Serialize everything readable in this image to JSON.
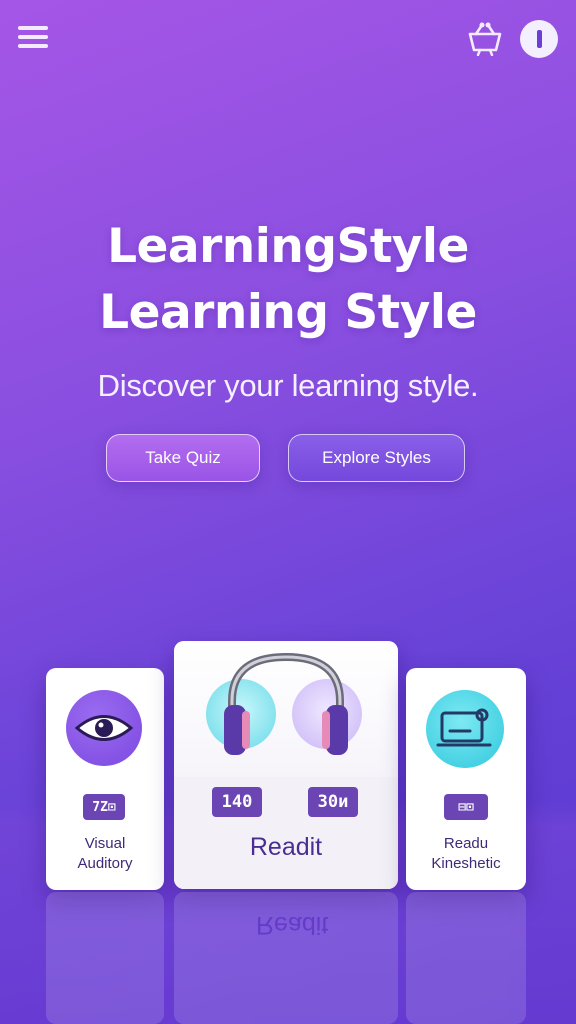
{
  "header": {
    "menu_icon": "hamburger-menu-icon",
    "basket_icon": "basket-icon",
    "info_icon": "info-icon"
  },
  "hero": {
    "title_line1": "LearningStyle",
    "title_line2": "Learning Style",
    "subtitle": "Discover your learning style."
  },
  "actions": {
    "take_quiz": "Take Quiz",
    "explore_styles": "Explore Styles"
  },
  "cards": {
    "left": {
      "icon": "eye-icon",
      "badge": "7Z⊡",
      "label_line1": "Visual",
      "label_line2": "Auditory"
    },
    "center": {
      "icon": "headphones-icon",
      "badge_left": "140",
      "badge_right": "30и",
      "label": "Readit"
    },
    "right": {
      "icon": "monitor-icon",
      "badge": "⊟⊡",
      "label_line1": "Readu",
      "label_line2": "Kineshetic"
    }
  },
  "reflection": {
    "label": "Readit"
  },
  "colors": {
    "background_start": "#a556e6",
    "background_end": "#5536cf",
    "card": "#ffffff",
    "badge": "#6a45b3",
    "accent_text": "#4a2e92"
  }
}
